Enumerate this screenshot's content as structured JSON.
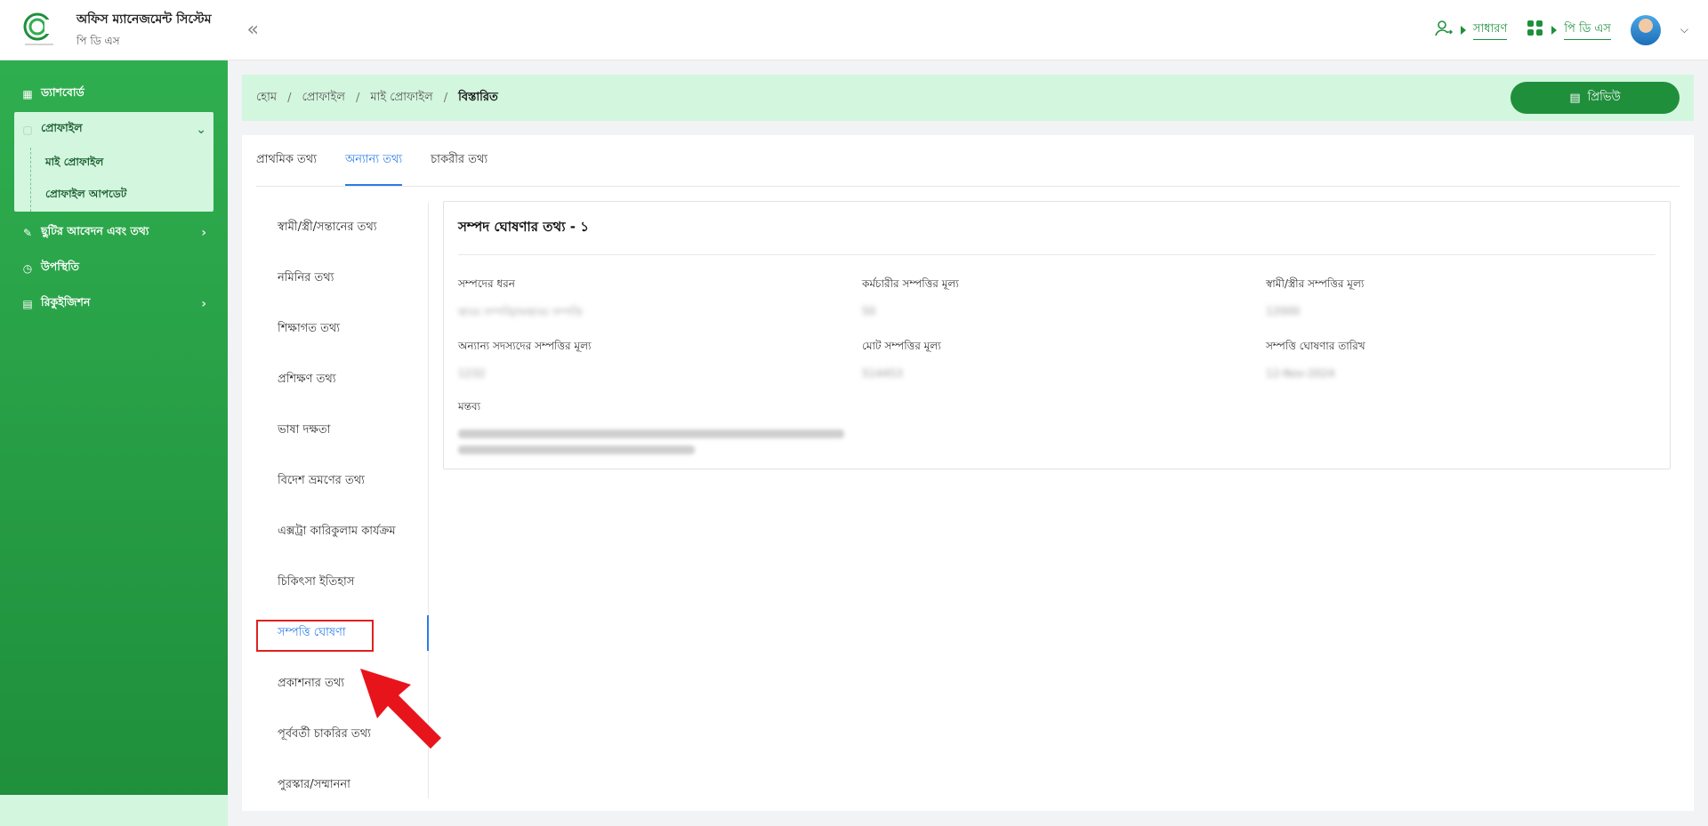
{
  "header": {
    "app_title": "অফিস ম্যানেজমেন্ট সিস্টেম",
    "app_subtitle": "পি ডি এস",
    "role_label": "সাধারণ",
    "module_label": "পি ডি এস"
  },
  "sidebar": {
    "items": [
      {
        "label": "ড্যাশবোর্ড"
      },
      {
        "label": "প্রোফাইল"
      },
      {
        "label": "মাই প্রোফাইল"
      },
      {
        "label": "প্রোফাইল আপডেট"
      },
      {
        "label": "ছুটির আবেদন এবং তথ্য"
      },
      {
        "label": "উপস্থিতি"
      },
      {
        "label": "রিকুইজিশন"
      }
    ]
  },
  "breadcrumb": [
    "হোম",
    "প্রোফাইল",
    "মাই প্রোফাইল",
    "বিস্তারিত"
  ],
  "preview_button": "প্রিভিউ",
  "tabs": [
    "প্রাথমিক তথ্য",
    "অন্যান্য তথ্য",
    "চাকরীর তথ্য"
  ],
  "vertical_menu": [
    "স্বামী/স্ত্রী/সন্তানের তথ্য",
    "নমিনির তথ্য",
    "শিক্ষাগত তথ্য",
    "প্রশিক্ষণ তথ্য",
    "ভাষা দক্ষতা",
    "বিদেশ ভ্রমণের তথ্য",
    "এক্সট্রা কারিকুলাম কার্যক্রম",
    "চিকিৎসা ইতিহাস",
    "সম্পত্তি ঘোষণা",
    "প্রকাশনার তথ্য",
    "পূর্ববর্তী চাকরির তথ্য",
    "পুরস্কার/সম্মাননা"
  ],
  "detail": {
    "title": "সম্পদ ঘোষণার তথ্য - ১",
    "fields": [
      {
        "label": "সম্পদের ধরন",
        "value": "স্থাবর সম্পত্তি/অস্থাবর সম্পত্তি"
      },
      {
        "label": "কর্মচারীর সম্পত্তির মূল্য",
        "value": "50"
      },
      {
        "label": "স্বামী/স্ত্রীর সম্পত্তির মূল্য",
        "value": "12000"
      },
      {
        "label": "অন্যান্য সদস্যদের সম্পত্তির মূল্য",
        "value": "1232"
      },
      {
        "label": "মোট সম্পত্তির মূল্য",
        "value": "514453"
      },
      {
        "label": "সম্পত্তি ঘোষণার তারিখ",
        "value": "12-Nov-2024"
      }
    ],
    "remarks_label": "মন্তব্য"
  },
  "colors": {
    "accent_green": "#1f8f3c",
    "light_green": "#d3f6df",
    "link_blue": "#2b7de9",
    "highlight_red": "#e02020"
  }
}
